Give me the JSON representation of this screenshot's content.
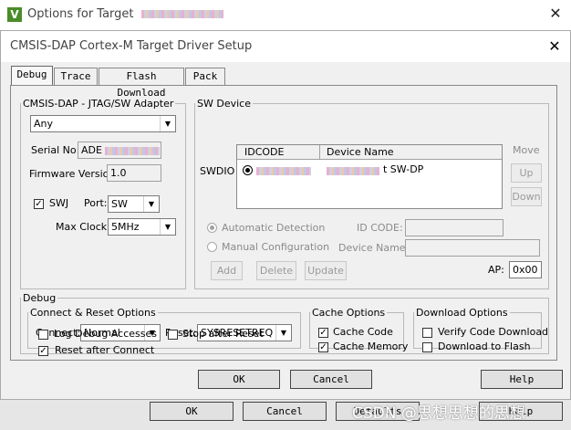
{
  "outer": {
    "title": "Options for Target",
    "ok": "OK",
    "cancel": "Cancel",
    "defaults": "Defaults",
    "help": "Help"
  },
  "dialog": {
    "title": "CMSIS-DAP Cortex-M Target Driver Setup"
  },
  "tabs": [
    {
      "label": "Debug"
    },
    {
      "label": "Trace"
    },
    {
      "label": "Flash Download"
    },
    {
      "label": "Pack"
    }
  ],
  "adapter": {
    "legend": "CMSIS-DAP - JTAG/SW Adapter",
    "selected": "Any",
    "serial_label": "Serial No:",
    "serial_value": "ADE",
    "firmware_label": "Firmware Version:",
    "firmware_value": "1.0",
    "swj_label": "SWJ",
    "swj_checked": true,
    "port_label": "Port:",
    "port_value": "SW",
    "clock_label": "Max Clock:",
    "clock_value": "5MHz"
  },
  "sw_device": {
    "legend": "SW Device",
    "row_label": "SWDIO",
    "col_idcode": "IDCODE",
    "col_name": "Device Name",
    "row_name_suffix": "t SW-DP",
    "move_label": "Move",
    "up": "Up",
    "down": "Down",
    "auto_detect": "Automatic Detection",
    "manual_config": "Manual Configuration",
    "id_code_label": "ID CODE:",
    "device_name_label": "Device Name:",
    "add": "Add",
    "delete": "Delete",
    "update": "Update",
    "ap_label": "AP:",
    "ap_value": "0x00"
  },
  "debug": {
    "legend": "Debug",
    "connect_legend": "Connect & Reset Options",
    "connect_label": "Connect:",
    "connect_value": "Normal",
    "reset_label": "Reset:",
    "reset_value": "SYSRESETREQ",
    "reset_after_connect": "Reset after Connect",
    "log_debug": "Log Debug Accesses",
    "stop_after_reset": "Stop after Reset",
    "cache_legend": "Cache Options",
    "cache_code": "Cache Code",
    "cache_memory": "Cache Memory",
    "download_legend": "Download Options",
    "verify_download": "Verify Code Download",
    "download_flash": "Download to Flash"
  },
  "buttons": {
    "ok": "OK",
    "cancel": "Cancel",
    "help": "Help"
  },
  "watermark": "CSDN @思想思想的思想"
}
